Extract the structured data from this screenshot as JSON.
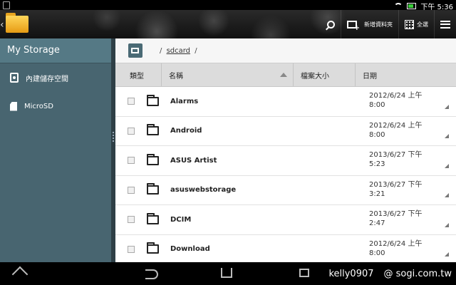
{
  "status_bar": {
    "time": "下午 5:36"
  },
  "action_bar": {
    "search_label": "",
    "new_folder_label": "新增資料夾",
    "select_all_label": "全選"
  },
  "sidebar": {
    "title": "My Storage",
    "items": [
      {
        "label": "內建儲存空間",
        "icon": "hdd-icon"
      },
      {
        "label": "MicroSD",
        "icon": "sd-card-icon"
      }
    ]
  },
  "path": {
    "prefix": "/",
    "crumb": "sdcard",
    "suffix": "/"
  },
  "columns": {
    "type": "類型",
    "name": "名稱",
    "size": "檔案大小",
    "date": "日期"
  },
  "files": [
    {
      "name": "Alarms",
      "date1": "2012/6/24 上午",
      "date2": "8:00"
    },
    {
      "name": "Android",
      "date1": "2012/6/24 上午",
      "date2": "8:00"
    },
    {
      "name": "ASUS Artist",
      "date1": "2013/6/27 下午",
      "date2": "5:23"
    },
    {
      "name": "asuswebstorage",
      "date1": "2013/6/27 下午",
      "date2": "3:21"
    },
    {
      "name": "DCIM",
      "date1": "2013/6/27 下午",
      "date2": "2:47"
    },
    {
      "name": "Download",
      "date1": "2012/6/24 上午",
      "date2": "8:00"
    }
  ],
  "watermark": {
    "author": "kelly0907",
    "site": "@ sogi.com.tw"
  },
  "colors": {
    "sidebar": "#486570",
    "folder_logo": "#f5b32a",
    "accent_battery": "#3ccc3c"
  }
}
